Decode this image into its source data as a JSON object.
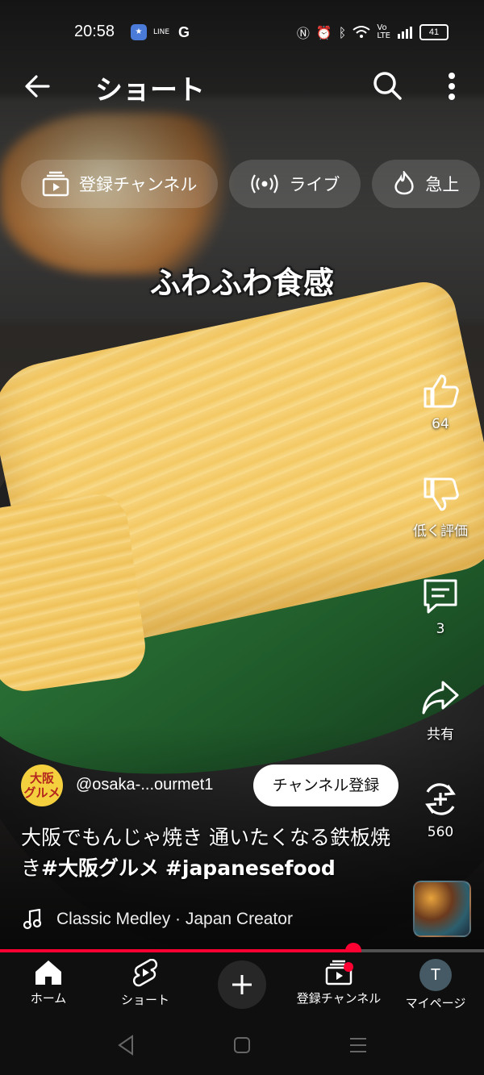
{
  "status_bar": {
    "time": "20:58",
    "apps": [
      "LINE",
      "G"
    ],
    "battery": "41"
  },
  "header": {
    "title": "ショート"
  },
  "chips": [
    {
      "label": "登録チャンネル",
      "icon": "subscriptions-icon"
    },
    {
      "label": "ライブ",
      "icon": "live-icon"
    },
    {
      "label": "急上",
      "icon": "trending-icon"
    }
  ],
  "video": {
    "caption": "ふわふわ食感",
    "channel_avatar": "大阪グルメ",
    "channel_name": "@osaka-...ourmet1",
    "subscribe_label": "チャンネル登録",
    "description_text": "大阪でもんじゃ焼き 通いたくなる鉄板焼き",
    "hashtags": [
      "#大阪グルメ",
      "#japanesefood"
    ],
    "music": "Classic Medley · Japan Creator",
    "progress": 0.73
  },
  "actions": {
    "like_count": "64",
    "dislike_label": "低く評価",
    "comment_count": "3",
    "share_label": "共有",
    "remix_count": "560"
  },
  "bottom_nav": {
    "home": "ホーム",
    "shorts": "ショート",
    "subscriptions": "登録チャンネル",
    "you": "マイページ",
    "you_avatar": "T"
  },
  "colors": {
    "accent": "#ff0033",
    "nav_bg": "#0f0f0f"
  }
}
